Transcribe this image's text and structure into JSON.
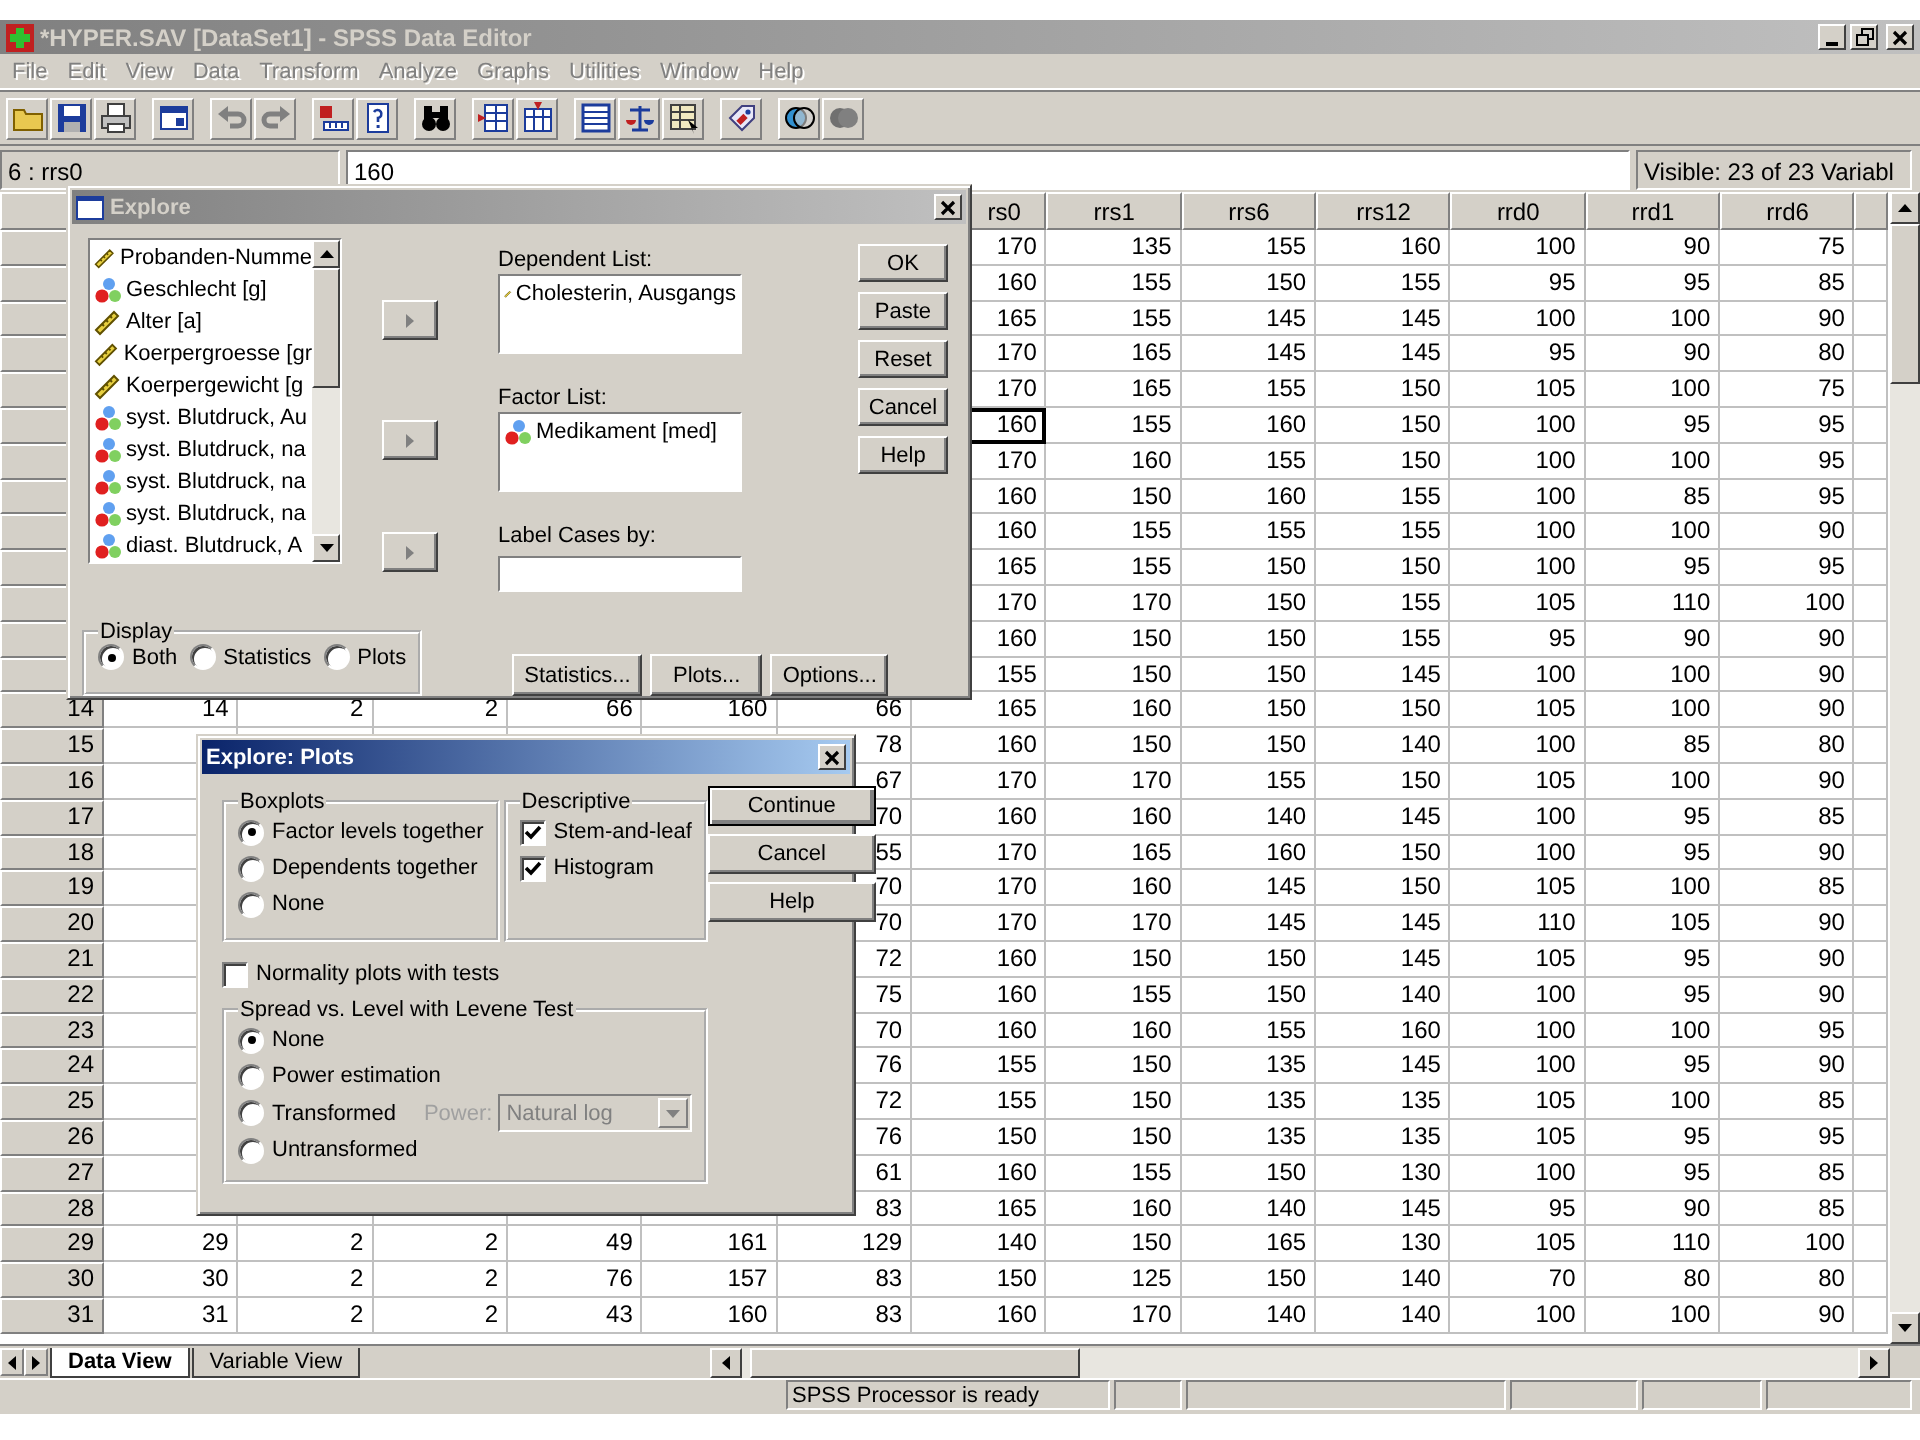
{
  "main_window": {
    "title": "*HYPER.SAV [DataSet1] - SPSS Data Editor",
    "active": false
  },
  "menu": [
    {
      "label": "File",
      "disabled": true
    },
    {
      "label": "Edit",
      "disabled": true
    },
    {
      "label": "View",
      "disabled": true
    },
    {
      "label": "Data",
      "disabled": true
    },
    {
      "label": "Transform",
      "disabled": true
    },
    {
      "label": "Analyze",
      "disabled": true
    },
    {
      "label": "Graphs",
      "disabled": true
    },
    {
      "label": "Utilities",
      "disabled": true
    },
    {
      "label": "Window",
      "disabled": true
    },
    {
      "label": "Help",
      "disabled": true
    }
  ],
  "cell_editor": {
    "cell": "6 : rrs0",
    "value": "160",
    "visible": "Visible: 23 of 23 Variabl"
  },
  "grid": {
    "columns": [
      null,
      null,
      null,
      null,
      null,
      null,
      {
        "label": "rs0",
        "clipped": true
      },
      {
        "label": "rrs1",
        "clipped": false
      },
      {
        "label": "rrs6",
        "clipped": false
      },
      {
        "label": "rrs12",
        "clipped": false
      },
      {
        "label": "rrd0",
        "clipped": false
      },
      {
        "label": "rrd1",
        "clipped": false
      },
      {
        "label": "rrd6",
        "clipped": false
      },
      null
    ],
    "rows": [
      {
        "cells": [
          null,
          null,
          null,
          null,
          null,
          null,
          "170",
          "135",
          "155",
          "160",
          "100",
          "90",
          "75"
        ]
      },
      {
        "cells": [
          null,
          null,
          null,
          null,
          null,
          null,
          "160",
          "155",
          "150",
          "155",
          "95",
          "95",
          "85"
        ]
      },
      {
        "cells": [
          null,
          null,
          null,
          null,
          null,
          null,
          "165",
          "155",
          "145",
          "145",
          "100",
          "100",
          "90"
        ]
      },
      {
        "cells": [
          null,
          null,
          null,
          null,
          null,
          null,
          "170",
          "165",
          "145",
          "145",
          "95",
          "90",
          "80"
        ]
      },
      {
        "cells": [
          null,
          null,
          null,
          null,
          null,
          null,
          "170",
          "165",
          "155",
          "150",
          "105",
          "100",
          "75"
        ]
      },
      {
        "cells": [
          null,
          null,
          null,
          null,
          null,
          null,
          {
            "value": "160",
            "selected": true
          },
          "155",
          "160",
          "150",
          "100",
          "95",
          "95"
        ]
      },
      {
        "cells": [
          null,
          null,
          null,
          null,
          null,
          null,
          "170",
          "160",
          "155",
          "150",
          "100",
          "100",
          "95"
        ]
      },
      {
        "cells": [
          null,
          null,
          null,
          null,
          null,
          null,
          "160",
          "150",
          "160",
          "155",
          "100",
          "85",
          "95"
        ]
      },
      {
        "cells": [
          null,
          null,
          null,
          null,
          null,
          null,
          "160",
          "155",
          "155",
          "155",
          "100",
          "100",
          "90"
        ]
      },
      {
        "cells": [
          null,
          null,
          null,
          null,
          null,
          null,
          "165",
          "155",
          "150",
          "150",
          "100",
          "95",
          "95"
        ]
      },
      {
        "cells": [
          null,
          null,
          null,
          null,
          null,
          null,
          "170",
          "170",
          "150",
          "155",
          "105",
          "110",
          "100"
        ]
      },
      {
        "cells": [
          null,
          null,
          null,
          null,
          null,
          null,
          "160",
          "150",
          "150",
          "155",
          "95",
          "90",
          "90"
        ]
      },
      {
        "cells": [
          null,
          null,
          null,
          null,
          null,
          null,
          "155",
          "150",
          "150",
          "145",
          "100",
          "100",
          "90"
        ]
      },
      {
        "label": "14",
        "cells": [
          "14",
          "2",
          "2",
          "66",
          "160",
          "66",
          "165",
          "160",
          "150",
          "150",
          "105",
          "100",
          "90"
        ]
      },
      {
        "label": "15",
        "cells": [
          null,
          null,
          null,
          null,
          null,
          "78",
          "160",
          "150",
          "150",
          "140",
          "100",
          "85",
          "80"
        ]
      },
      {
        "label": "16",
        "cells": [
          null,
          null,
          null,
          null,
          null,
          "67",
          "170",
          "170",
          "155",
          "150",
          "105",
          "100",
          "90"
        ]
      },
      {
        "label": "17",
        "cells": [
          null,
          null,
          null,
          null,
          null,
          "70",
          "160",
          "160",
          "140",
          "145",
          "100",
          "95",
          "85"
        ]
      },
      {
        "label": "18",
        "cells": [
          null,
          null,
          null,
          null,
          null,
          "55",
          "170",
          "165",
          "160",
          "150",
          "100",
          "95",
          "90"
        ]
      },
      {
        "label": "19",
        "cells": [
          null,
          null,
          null,
          null,
          null,
          "70",
          "170",
          "160",
          "145",
          "150",
          "105",
          "100",
          "85"
        ]
      },
      {
        "label": "20",
        "cells": [
          null,
          null,
          null,
          null,
          null,
          "70",
          "170",
          "170",
          "145",
          "145",
          "110",
          "105",
          "90"
        ]
      },
      {
        "label": "21",
        "cells": [
          null,
          null,
          null,
          null,
          null,
          "72",
          "160",
          "150",
          "150",
          "145",
          "105",
          "95",
          "90"
        ]
      },
      {
        "label": "22",
        "cells": [
          null,
          null,
          null,
          null,
          null,
          "75",
          "160",
          "155",
          "150",
          "140",
          "100",
          "95",
          "90"
        ]
      },
      {
        "label": "23",
        "cells": [
          null,
          null,
          null,
          null,
          null,
          "70",
          "160",
          "160",
          "155",
          "160",
          "100",
          "100",
          "95"
        ]
      },
      {
        "label": "24",
        "cells": [
          null,
          null,
          null,
          null,
          null,
          "76",
          "155",
          "150",
          "135",
          "145",
          "100",
          "95",
          "90"
        ]
      },
      {
        "label": "25",
        "cells": [
          null,
          null,
          null,
          null,
          null,
          "72",
          "155",
          "150",
          "135",
          "135",
          "105",
          "100",
          "85"
        ]
      },
      {
        "label": "26",
        "cells": [
          null,
          null,
          null,
          null,
          null,
          "76",
          "150",
          "150",
          "135",
          "135",
          "105",
          "95",
          "95"
        ]
      },
      {
        "label": "27",
        "cells": [
          null,
          null,
          null,
          null,
          null,
          "61",
          "160",
          "155",
          "150",
          "130",
          "100",
          "95",
          "85"
        ]
      },
      {
        "label": "28",
        "cells": [
          null,
          null,
          null,
          null,
          null,
          "83",
          "165",
          "160",
          "140",
          "145",
          "95",
          "90",
          "85"
        ]
      },
      {
        "label": "29",
        "cells": [
          "29",
          "2",
          "2",
          "49",
          "161",
          "129",
          "140",
          "150",
          "165",
          "130",
          "105",
          "110",
          "100"
        ]
      },
      {
        "label": "30",
        "cells": [
          "30",
          "2",
          "2",
          "76",
          "157",
          "83",
          "150",
          "125",
          "150",
          "140",
          "70",
          "80",
          "80"
        ]
      },
      {
        "label": "31",
        "cells": [
          "31",
          "2",
          "2",
          "43",
          "160",
          "83",
          "160",
          "170",
          "140",
          "140",
          "100",
          "100",
          "90"
        ]
      }
    ]
  },
  "tabs": [
    {
      "label": "Data View",
      "selected": true
    },
    {
      "label": "Variable View",
      "selected": false
    }
  ],
  "status_bar": {
    "message": "SPSS Processor is ready"
  },
  "explore": {
    "title": "Explore",
    "active": false,
    "variables": [
      {
        "label": "Probanden-Numme",
        "kind": "scale"
      },
      {
        "label": "Geschlecht [g]",
        "kind": "nominal"
      },
      {
        "label": "Alter [a]",
        "kind": "scale"
      },
      {
        "label": "Koerpergroesse [gr",
        "kind": "scale"
      },
      {
        "label": "Koerpergewicht [g",
        "kind": "scale"
      },
      {
        "label": "syst. Blutdruck, Au",
        "kind": "nominal"
      },
      {
        "label": "syst. Blutdruck, na",
        "kind": "nominal"
      },
      {
        "label": "syst. Blutdruck, na",
        "kind": "nominal"
      },
      {
        "label": "syst. Blutdruck, na",
        "kind": "nominal"
      },
      {
        "label": "diast. Blutdruck, A",
        "kind": "nominal"
      }
    ],
    "dependent_list": {
      "label": "Dependent List:",
      "items": [
        {
          "label": "Cholesterin, Ausgangs",
          "kind": "scale"
        }
      ]
    },
    "factor_list": {
      "label": "Factor List:",
      "items": [
        {
          "label": "Medikament [med]",
          "kind": "nominal"
        }
      ]
    },
    "label_cases": {
      "label": "Label Cases by:"
    },
    "display": {
      "legend": "Display",
      "options": [
        {
          "label": "Both",
          "selected": true
        },
        {
          "label": "Statistics",
          "selected": false
        },
        {
          "label": "Plots",
          "selected": false
        }
      ]
    },
    "buttons": [
      "OK",
      "Paste",
      "Reset",
      "Cancel",
      "Help"
    ],
    "bottom_buttons": [
      "Statistics...",
      "Plots...",
      "Options..."
    ]
  },
  "plots": {
    "title": "Explore: Plots",
    "active": true,
    "boxplots": {
      "legend": "Boxplots",
      "options": [
        {
          "label": "Factor levels together",
          "selected": true
        },
        {
          "label": "Dependents together",
          "selected": false
        },
        {
          "label": "None",
          "selected": false
        }
      ]
    },
    "descriptive": {
      "legend": "Descriptive",
      "options": [
        {
          "label": "Stem-and-leaf",
          "checked": true
        },
        {
          "label": "Histogram",
          "checked": true
        }
      ]
    },
    "normality": {
      "label": "Normality plots with tests",
      "checked": false
    },
    "spread": {
      "legend": "Spread vs. Level with Levene Test",
      "options": [
        {
          "label": "None",
          "selected": true
        },
        {
          "label": "Power estimation",
          "selected": false
        },
        {
          "label": "Transformed",
          "selected": false,
          "power": {
            "label": "Power:",
            "value": "Natural log",
            "disabled": true
          }
        },
        {
          "label": "Untransformed",
          "selected": false
        }
      ]
    },
    "buttons": [
      {
        "label": "Continue",
        "default": true
      },
      {
        "label": "Cancel",
        "default": false
      },
      {
        "label": "Help",
        "default": false
      }
    ]
  }
}
